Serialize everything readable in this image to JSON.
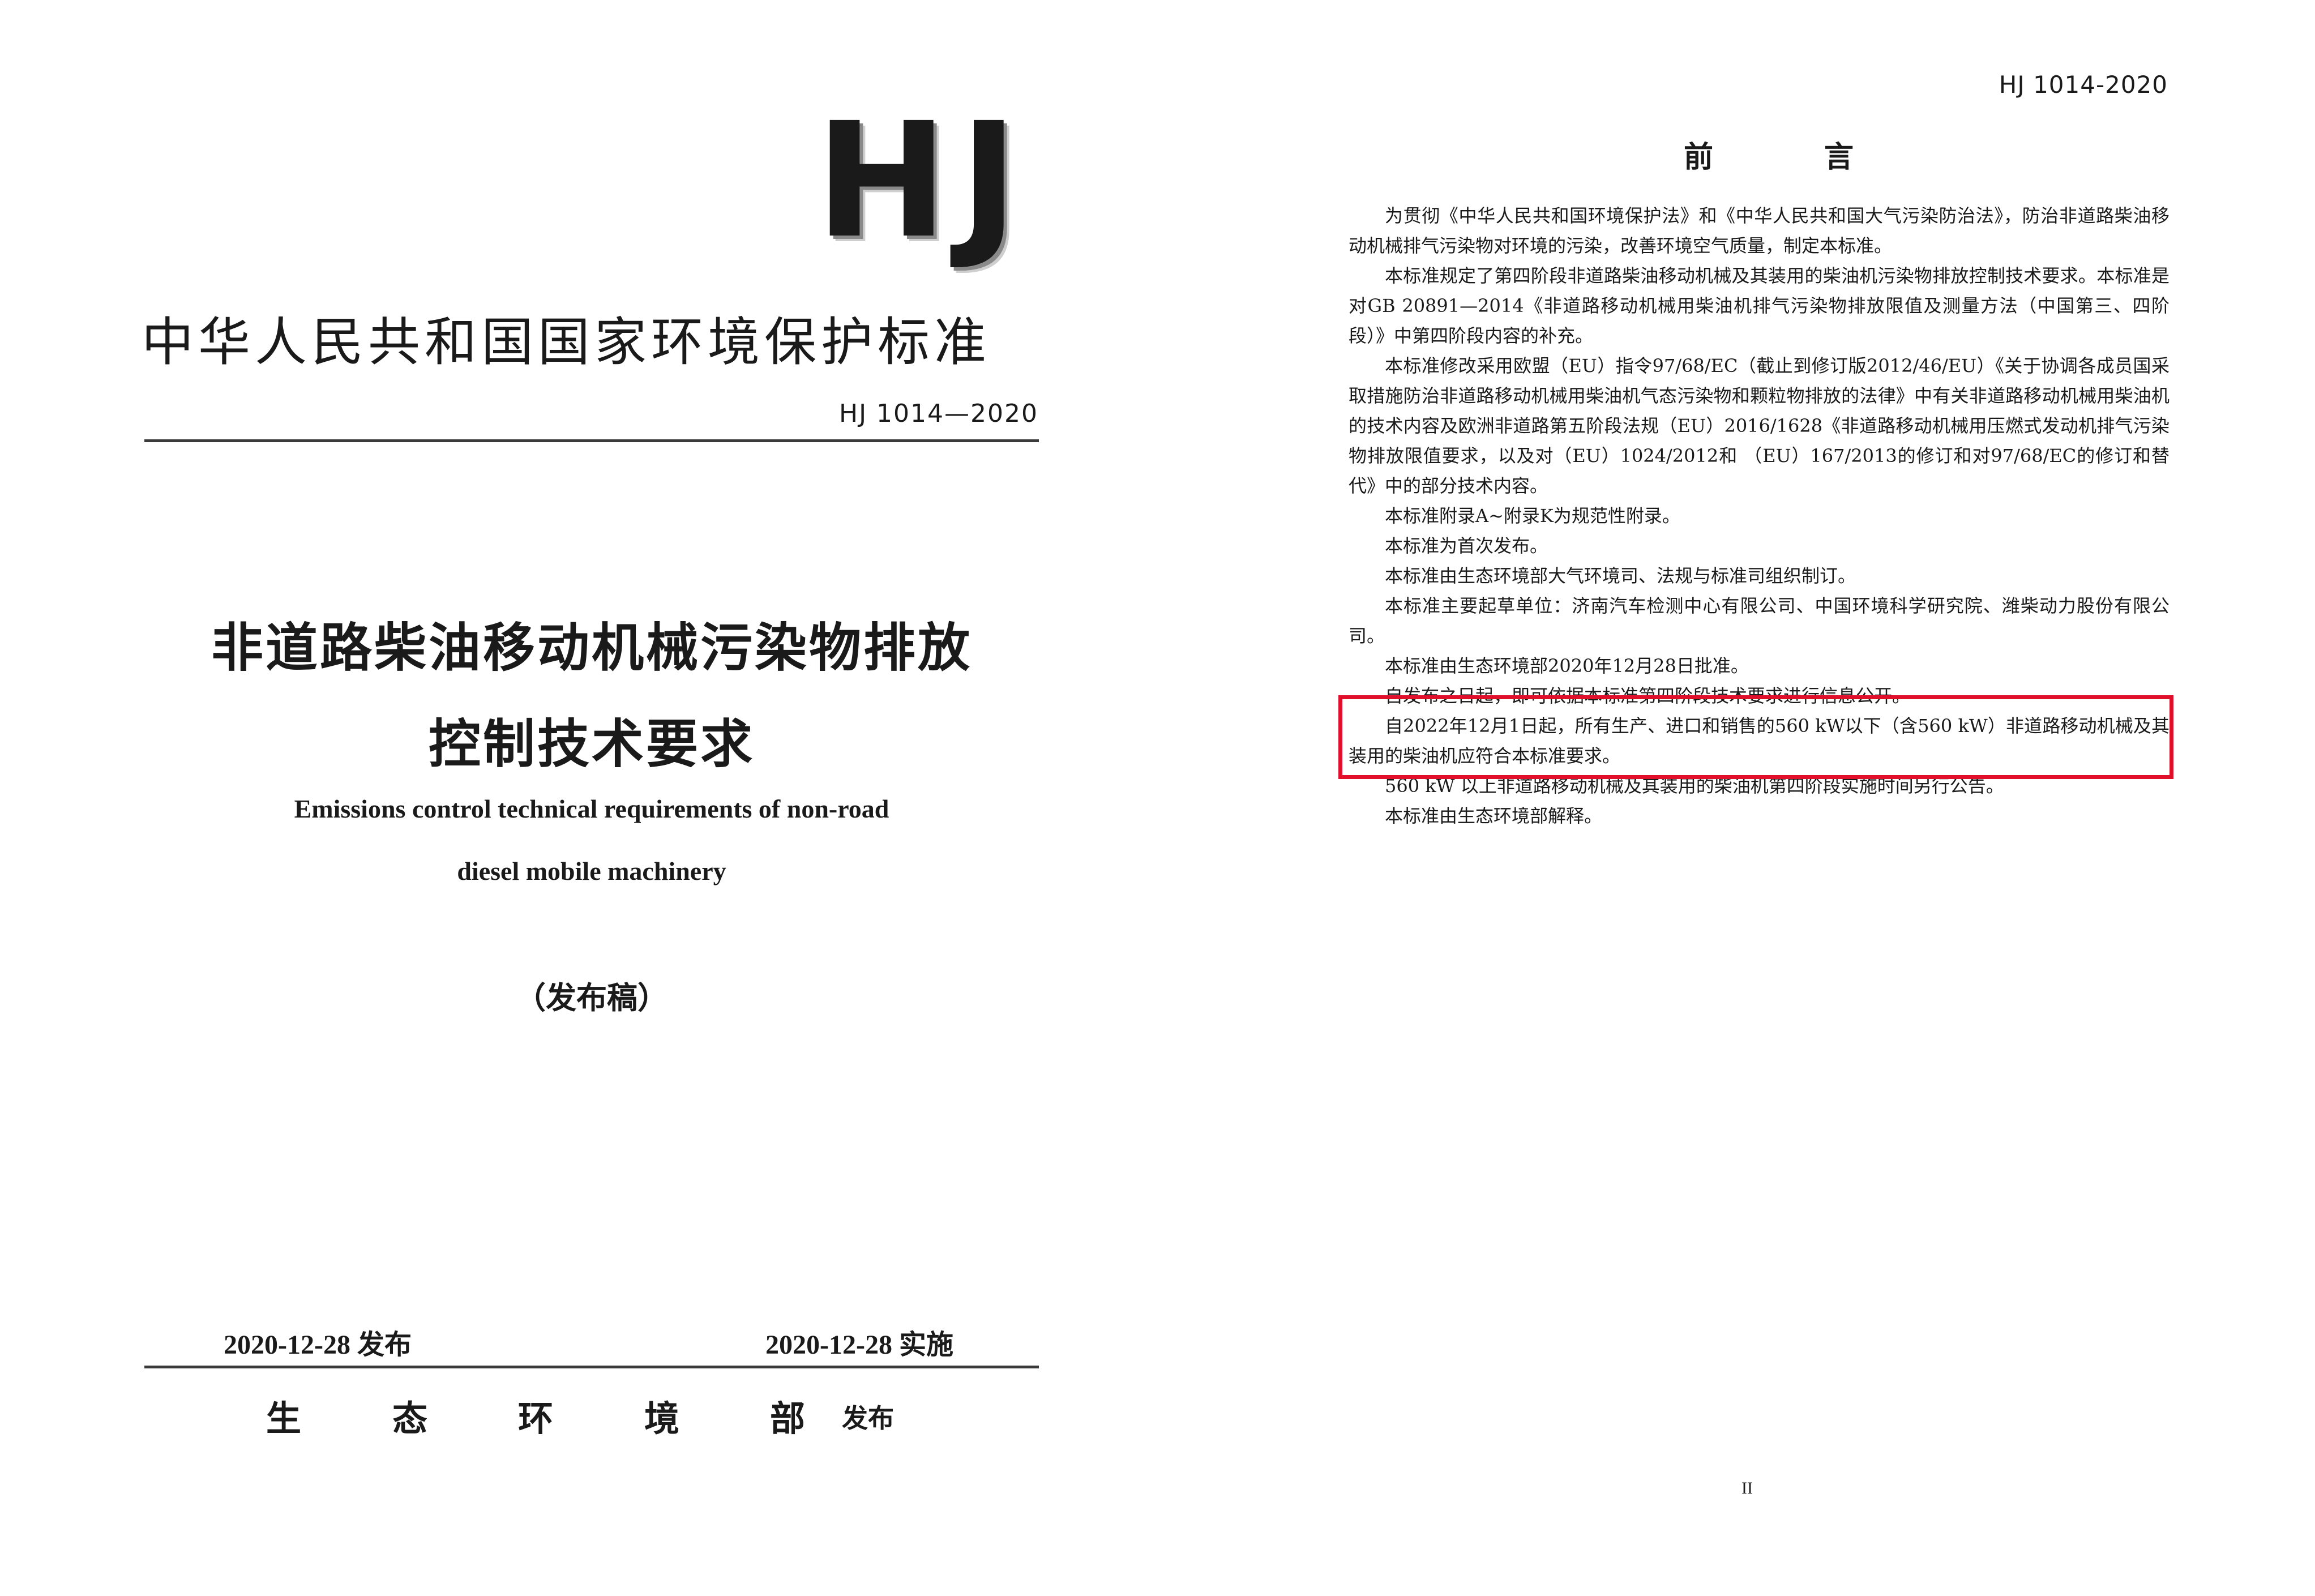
{
  "cover": {
    "logo": "HJ",
    "agency": "中华人民共和国国家环境保护标准",
    "standard_no": "HJ 1014—2020",
    "title_line1": "非道路柴油移动机械污染物排放",
    "title_line2": "控制技术要求",
    "title_en_line1": "Emissions control technical requirements of non-road",
    "title_en_line2": "diesel mobile machinery",
    "draft_label": "（发布稿）",
    "issue_date": "2020-12-28 发布",
    "effective_date": "2020-12-28 实施",
    "ministry_chars": [
      "生",
      "态",
      "环",
      "境",
      "部"
    ],
    "publish_label": "发布"
  },
  "preface": {
    "header_no": "HJ 1014-2020",
    "title_chars": [
      "前",
      "言"
    ],
    "paragraphs": [
      "为贯彻《中华人民共和国环境保护法》和《中华人民共和国大气污染防治法》，防治非道路柴油移动机械排气污染物对环境的污染，改善环境空气质量，制定本标准。",
      "本标准规定了第四阶段非道路柴油移动机械及其装用的柴油机污染物排放控制技术要求。本标准是对GB 20891—2014《非道路移动机械用柴油机排气污染物排放限值及测量方法（中国第三、四阶段）》中第四阶段内容的补充。",
      "本标准修改采用欧盟（EU）指令97/68/EC（截止到修订版2012/46/EU）《关于协调各成员国采取措施防治非道路移动机械用柴油机气态污染物和颗粒物排放的法律》中有关非道路移动机械用柴油机的技术内容及欧洲非道路第五阶段法规（EU）2016/1628《非道路移动机械用压燃式发动机排气污染物排放限值要求，以及对（EU）1024/2012和 （EU）167/2013的修订和对97/68/EC的修订和替代》中的部分技术内容。",
      "本标准附录A~附录K为规范性附录。",
      "本标准为首次发布。",
      "本标准由生态环境部大气环境司、法规与标准司组织制订。",
      "本标准主要起草单位：济南汽车检测中心有限公司、中国环境科学研究院、潍柴动力股份有限公司。",
      "本标准由生态环境部2020年12月28日批准。",
      "自发布之日起，即可依据本标准第四阶段技术要求进行信息公开。",
      "自2022年12月1日起，所有生产、进口和销售的560 kW以下（含560 kW）非道路移动机械及其装用的柴油机应符合本标准要求。",
      "560 kW 以上非道路移动机械及其装用的柴油机第四阶段实施时间另行公告。",
      "本标准由生态环境部解释。"
    ],
    "page_number": "II",
    "highlight_color": "#e0102a"
  }
}
